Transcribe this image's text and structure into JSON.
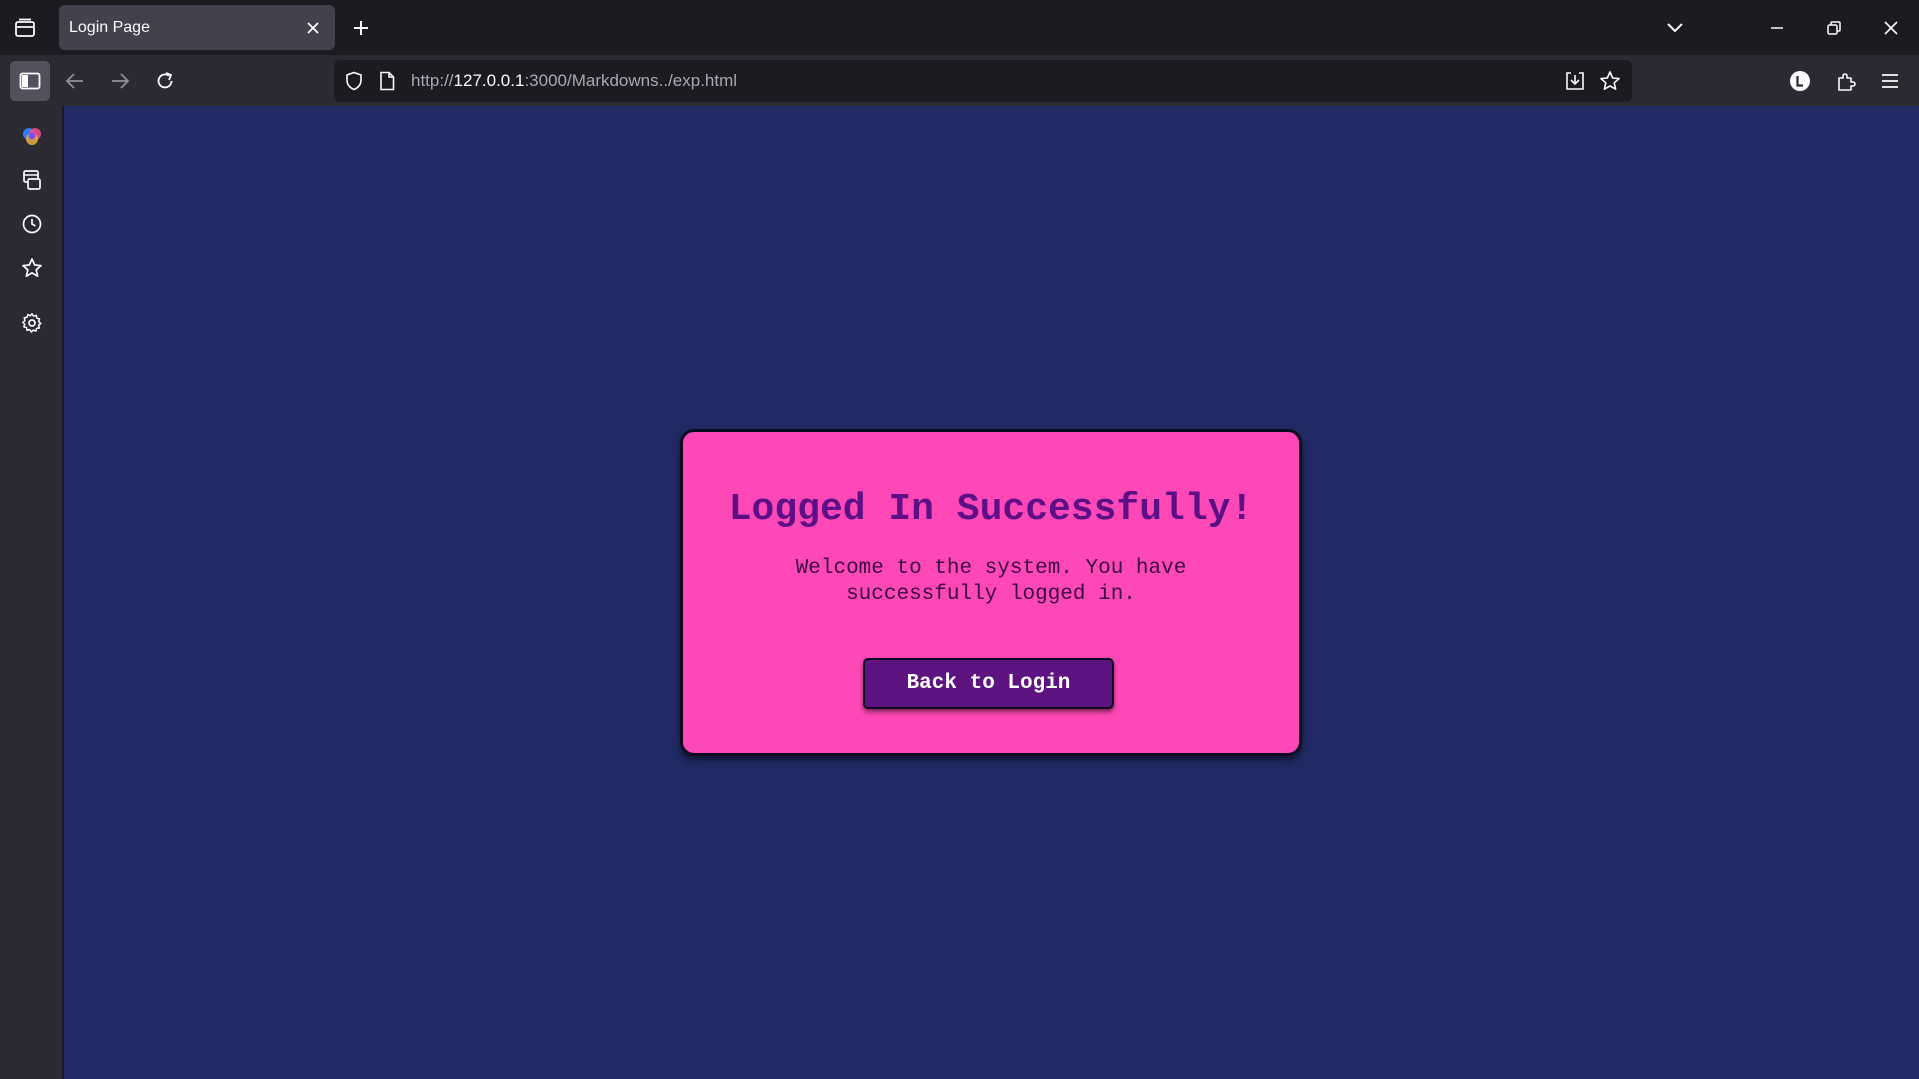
{
  "browser": {
    "tab": {
      "title": "Login Page"
    },
    "url": {
      "prefix": "http://",
      "host": "127.0.0.1",
      "rest": ":3000/Markdowns../exp.html"
    },
    "icons": {
      "tab_list": "tab-list-icon",
      "new_tab": "plus-icon",
      "list_all_tabs": "chevron-down-icon",
      "minimize": "minimize-icon",
      "restore": "restore-icon",
      "close_window": "close-icon",
      "sidebar_toggle": "sidebar-icon",
      "back": "arrow-left-icon",
      "forward": "arrow-right-icon",
      "reload": "reload-icon",
      "tracking_protection": "shield-icon",
      "page_info": "page-icon",
      "save_page": "download-icon",
      "bookmark": "star-icon",
      "account": "account-icon",
      "extensions": "puzzle-icon",
      "menu": "hamburger-icon"
    }
  },
  "sidebar": {
    "items": [
      {
        "icon": "copilot-icon"
      },
      {
        "icon": "synced-tabs-icon"
      },
      {
        "icon": "history-icon"
      },
      {
        "icon": "bookmarks-star-icon"
      },
      {
        "icon": "settings-gear-icon"
      }
    ]
  },
  "page": {
    "background_color": "#222a65",
    "card": {
      "title": "Logged In Successfully!",
      "message": "Welcome to the system. You have successfully logged in.",
      "button_label": "Back to Login",
      "background_color": "#ff48b8",
      "title_color": "#5d0f86",
      "button_color": "#5e1480"
    }
  }
}
